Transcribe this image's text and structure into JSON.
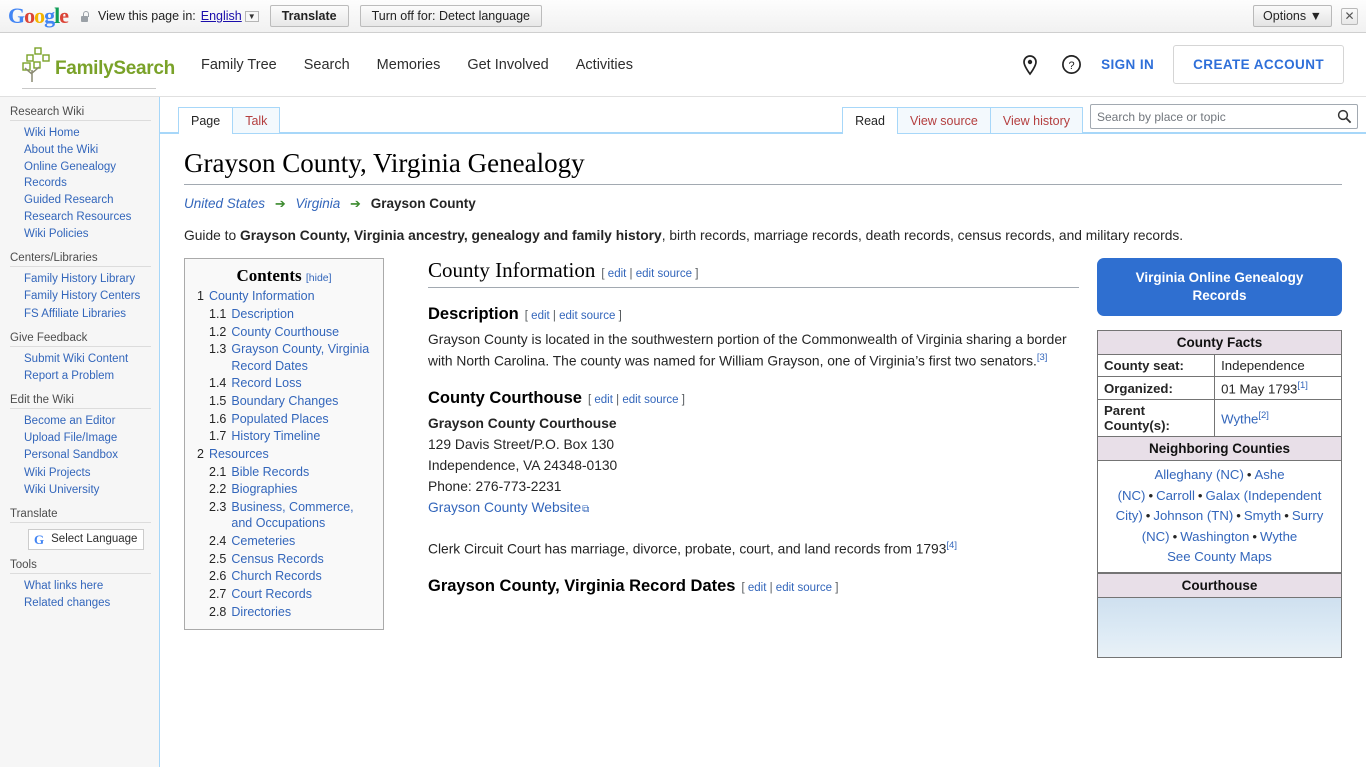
{
  "translate_bar": {
    "logo": "Google",
    "lock_icon": "lock-icon",
    "label": "View this page in:",
    "language": "English",
    "translate_button": "Translate",
    "turnoff_button": "Turn off for: Detect language",
    "options_button": "Options",
    "close_icon": "close-icon"
  },
  "header": {
    "brand": "FamilySearch",
    "nav": [
      {
        "label": "Family Tree"
      },
      {
        "label": "Search"
      },
      {
        "label": "Memories"
      },
      {
        "label": "Get Involved"
      },
      {
        "label": "Activities"
      }
    ],
    "location_icon": "location-pin-icon",
    "help_icon": "help-circle-icon",
    "sign_in": "SIGN IN",
    "create_account": "CREATE ACCOUNT",
    "accent_color": "#2e6fd9",
    "brand_color": "#7aa229"
  },
  "sidebar": {
    "groups": [
      {
        "heading": "Research Wiki",
        "items": [
          {
            "label": "Wiki Home"
          },
          {
            "label": "About the Wiki"
          },
          {
            "label": "Online Genealogy Records"
          },
          {
            "label": "Guided Research"
          },
          {
            "label": "Research Resources"
          },
          {
            "label": "Wiki Policies"
          }
        ]
      },
      {
        "heading": "Centers/Libraries",
        "items": [
          {
            "label": "Family History Library"
          },
          {
            "label": "Family History Centers"
          },
          {
            "label": "FS Affiliate Libraries"
          }
        ]
      },
      {
        "heading": "Give Feedback",
        "items": [
          {
            "label": "Submit Wiki Content"
          },
          {
            "label": "Report a Problem"
          }
        ]
      },
      {
        "heading": "Edit the Wiki",
        "items": [
          {
            "label": "Become an Editor"
          },
          {
            "label": "Upload File/Image"
          },
          {
            "label": "Personal Sandbox"
          },
          {
            "label": "Wiki Projects"
          },
          {
            "label": "Wiki University"
          }
        ]
      },
      {
        "heading": "Translate",
        "widget": {
          "icon": "google-g-icon",
          "label": "Select Language"
        },
        "items": []
      },
      {
        "heading": "Tools",
        "items": [
          {
            "label": "What links here"
          },
          {
            "label": "Related changes"
          }
        ]
      }
    ]
  },
  "tabs": {
    "left": [
      {
        "label": "Page",
        "active": true
      },
      {
        "label": "Talk",
        "active": false
      }
    ],
    "right": [
      {
        "label": "Read",
        "active": true
      },
      {
        "label": "View source",
        "active": false
      },
      {
        "label": "View history",
        "active": false
      }
    ]
  },
  "search": {
    "placeholder": "Search by place or topic",
    "value": "",
    "icon": "search-icon"
  },
  "page": {
    "title": "Grayson County, Virginia Genealogy",
    "breadcrumb": [
      {
        "label": "United States",
        "link": true
      },
      {
        "label": "Virginia",
        "link": true
      },
      {
        "label": "Grayson County",
        "link": false
      }
    ],
    "arrow_icon": "right-arrow-icon",
    "lede_prefix": "Guide to ",
    "lede_bold": "Grayson County, Virginia ancestry, genealogy and family history",
    "lede_suffix": ", birth records, marriage records, death records, census records, and military records."
  },
  "toc": {
    "title": "Contents",
    "hide_label": "[hide]",
    "entries": [
      {
        "num": "1",
        "label": "County Information",
        "level": 1
      },
      {
        "num": "1.1",
        "label": "Description",
        "level": 2
      },
      {
        "num": "1.2",
        "label": "County Courthouse",
        "level": 2
      },
      {
        "num": "1.3",
        "label": "Grayson County, Virginia Record Dates",
        "level": 2
      },
      {
        "num": "1.4",
        "label": "Record Loss",
        "level": 2
      },
      {
        "num": "1.5",
        "label": "Boundary Changes",
        "level": 2
      },
      {
        "num": "1.6",
        "label": "Populated Places",
        "level": 2
      },
      {
        "num": "1.7",
        "label": "History Timeline",
        "level": 2
      },
      {
        "num": "2",
        "label": "Resources",
        "level": 1
      },
      {
        "num": "2.1",
        "label": "Bible Records",
        "level": 2
      },
      {
        "num": "2.2",
        "label": "Biographies",
        "level": 2
      },
      {
        "num": "2.3",
        "label": "Business, Commerce, and Occupations",
        "level": 2
      },
      {
        "num": "2.4",
        "label": "Cemeteries",
        "level": 2
      },
      {
        "num": "2.5",
        "label": "Census Records",
        "level": 2
      },
      {
        "num": "2.6",
        "label": "Church Records",
        "level": 2
      },
      {
        "num": "2.7",
        "label": "Court Records",
        "level": 2
      },
      {
        "num": "2.8",
        "label": "Directories",
        "level": 2
      }
    ]
  },
  "main": {
    "section_title": "County Information",
    "edit_open": "[ ",
    "edit": "edit",
    "edit_sep": " | ",
    "edit_source": "edit source",
    "edit_close": " ]",
    "description": {
      "heading": "Description",
      "text": "Grayson County is located in the southwestern portion of the Commonwealth of Virginia sharing a border with North Carolina. The county was named for William Grayson, one of Virginia’s first two senators.",
      "ref": "[3]"
    },
    "courthouse": {
      "heading": "County Courthouse",
      "name": "Grayson County Courthouse",
      "street": "129 Davis Street/P.O. Box 130",
      "citystate": "Independence, VA 24348-0130",
      "phone": "Phone: 276-773-2231",
      "website": "Grayson County Website",
      "note": "Clerk Circuit Court has marriage, divorce, probate, court, and land records from 1793",
      "note_ref": "[4]"
    },
    "record_dates": {
      "heading": "Grayson County, Virginia Record Dates"
    }
  },
  "infobox": {
    "cta": "Virginia Online Genealogy Records",
    "cta_color": "#2f6fd0",
    "facts_header": "County Facts",
    "facts": [
      {
        "key": "County seat:",
        "value": "Independence",
        "ref": "",
        "link": false
      },
      {
        "key": "Organized:",
        "value": "01 May 1793",
        "ref": "[1]",
        "link": false
      },
      {
        "key": "Parent County(s):",
        "value": "Wythe",
        "ref": "[2]",
        "link": true
      }
    ],
    "neighbors_header": "Neighboring Counties",
    "neighbors": [
      "Alleghany (NC)",
      "Ashe (NC)",
      "Carroll",
      "Galax (Independent City)",
      "Johnson (TN)",
      "Smyth",
      "Surry (NC)",
      "Washington",
      "Wythe"
    ],
    "see_maps": "See County Maps",
    "courthouse_header": "Courthouse"
  }
}
